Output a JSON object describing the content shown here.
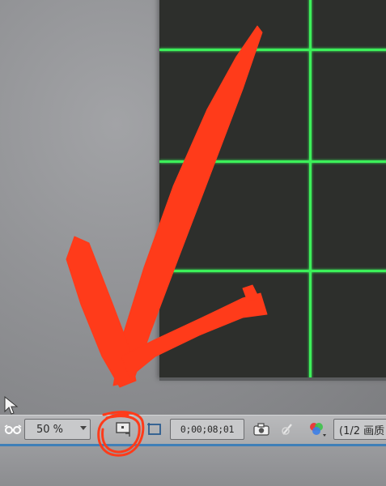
{
  "viewer": {
    "zoom_value": "50 %",
    "timecode": "0;00;08;01",
    "resolution": "(1/2 画质"
  },
  "icons": {
    "always_preview": "glasses-icon",
    "zoom_dropdown": "chevron-down-icon",
    "toggle_transparency_grid": "monitor-region-icon",
    "region_of_interest": "crop-region-icon",
    "snapshot": "camera-icon",
    "show_snapshot": "snapshot-toggle-icon",
    "show_channel": "color-channels-icon",
    "cursor": "mouse-pointer-icon"
  },
  "colors": {
    "grid": "#3cf05a",
    "annotation": "#ff3b1a",
    "panel_bg": "#2d2f2c",
    "toolbar_bg": "#b9babc",
    "accent_rule": "#3f7fb8"
  },
  "annotation": {
    "type": "hand-drawn checkmark and circle",
    "target": "toggle-transparency-grid-button"
  }
}
